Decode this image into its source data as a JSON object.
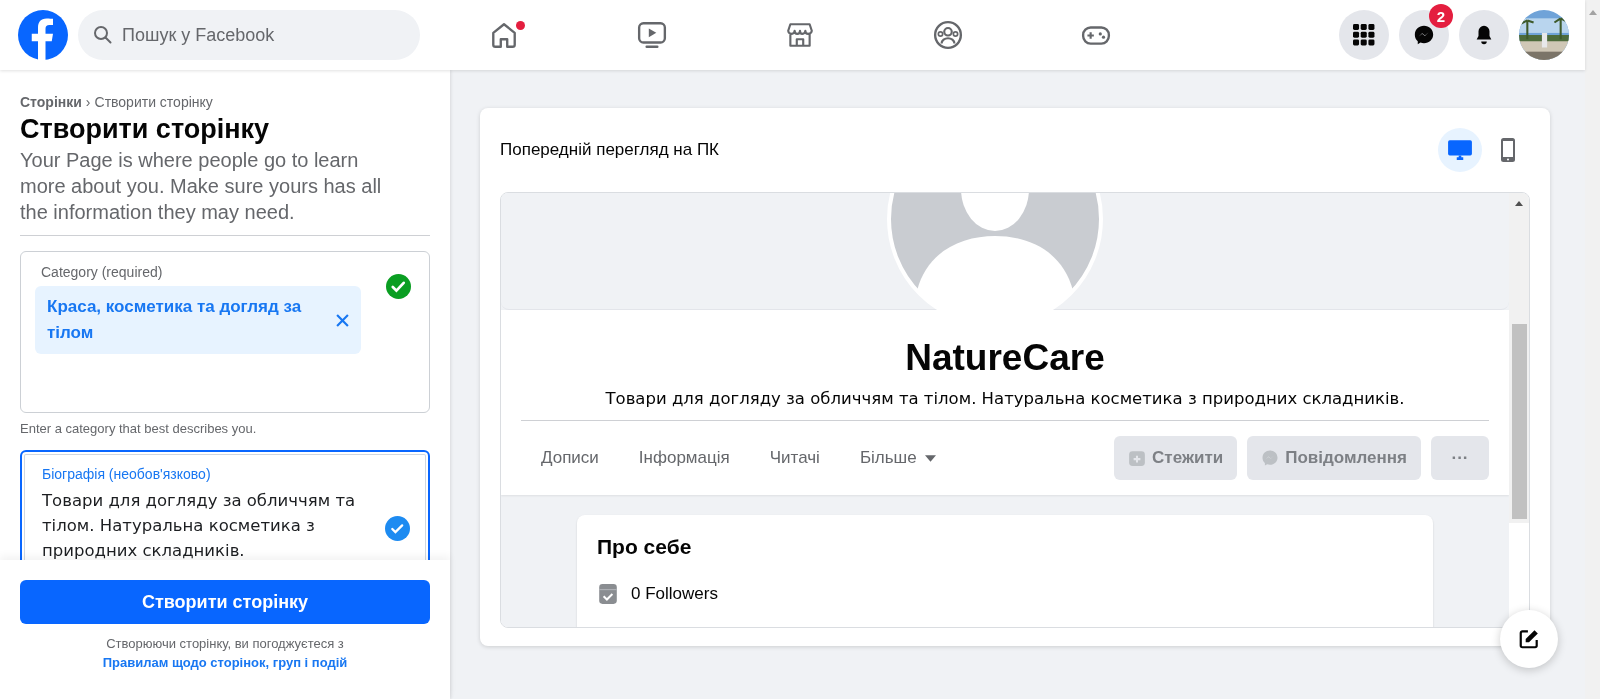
{
  "top_bar": {
    "search": {
      "placeholder": "Пошук у Facebook"
    },
    "nav_items": [
      {
        "kind": "home",
        "dot": true
      },
      {
        "kind": "video",
        "dot": false
      },
      {
        "kind": "marketplace",
        "dot": false
      },
      {
        "kind": "groups",
        "dot": false
      },
      {
        "kind": "gaming",
        "dot": false
      }
    ],
    "actions": [
      {
        "kind": "menu"
      },
      {
        "kind": "messenger",
        "badge": "2"
      },
      {
        "kind": "notifications"
      },
      {
        "kind": "avatar"
      }
    ]
  },
  "sidebar": {
    "breadcrumb": [
      "Сторінки",
      "Створити сторінку"
    ],
    "breadcrumb_separator": "›",
    "title": "Створити сторінку",
    "description": "Your Page is where people go to learn more about you. Make sure yours has all the information they may need.",
    "category_field": {
      "label": "Category (required)",
      "value": "Краса, косметика та догляд за тілом",
      "valid": true,
      "hint": "Enter a category that best describes you."
    },
    "bio_field": {
      "label": "Біографія (необов'язково)",
      "value": "Товари для догляду за обличчям та тілом. Натуральна косметика з природних складників.",
      "focused": true,
      "valid": true
    },
    "create_button": "Створити сторінку",
    "terms": {
      "text": "Створюючи сторінку, ви погоджуєтеся з",
      "link": "Правилам щодо сторінок, груп і подій"
    }
  },
  "preview": {
    "title": "Попередній перегляд на ПК",
    "view_modes": [
      {
        "kind": "desktop",
        "selected": true
      },
      {
        "kind": "mobile",
        "selected": false
      }
    ],
    "page": {
      "name": "NatureCare",
      "description": "Товари для догляду за обличчям та тілом. Натуральна косметика з природних складників.",
      "tabs": [
        {
          "label": "Дописи",
          "dropdown": false
        },
        {
          "label": "Інформація",
          "dropdown": false
        },
        {
          "label": "Читачі",
          "dropdown": false
        },
        {
          "label": "Більше",
          "dropdown": true
        }
      ],
      "buttons": [
        {
          "kind": "follow",
          "label": "Стежити"
        },
        {
          "kind": "message",
          "label": "Повідомлення"
        },
        {
          "kind": "more",
          "label": "···"
        }
      ],
      "about": {
        "title": "Про себе",
        "items": [
          {
            "text": "0 Followers"
          }
        ]
      }
    }
  }
}
